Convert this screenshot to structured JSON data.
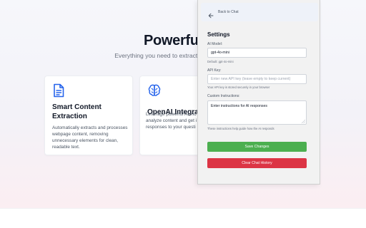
{
  "hero": {
    "title": "Powerful Fe",
    "subtitle": "Everything you need to extract, process, and unde"
  },
  "cards": [
    {
      "icon": "document-icon",
      "title": "Smart Content Extraction",
      "text": "Automatically extracts and processes webpage content, removing unnecessary elements for clean, readable text."
    },
    {
      "icon": "brain-icon",
      "title": "OpenAI Integrati",
      "text_lines": [
        "Leverage powerful AI mo",
        "analyze content and get i",
        "responses to your questi"
      ]
    }
  ],
  "settings": {
    "back_label": "Back to Chat",
    "title": "Settings",
    "model": {
      "label": "AI Model:",
      "value": "gpt-4o-mini",
      "hint": "Default: gpt-4o-mini"
    },
    "api_key": {
      "label": "API Key:",
      "placeholder": "Enter new API key (leave empty to keep current)",
      "hint": "Your API key is stored securely in your browser"
    },
    "instructions": {
      "label": "Custom Instructions:",
      "value": "Enter instructions for AI responses",
      "hint": "These instructions help guide how the AI responds"
    },
    "save_label": "Save Changes",
    "clear_label": "Clear Chat History"
  },
  "colors": {
    "accent_blue": "#2563eb",
    "save_green": "#4caf50",
    "clear_red": "#dc3545"
  }
}
